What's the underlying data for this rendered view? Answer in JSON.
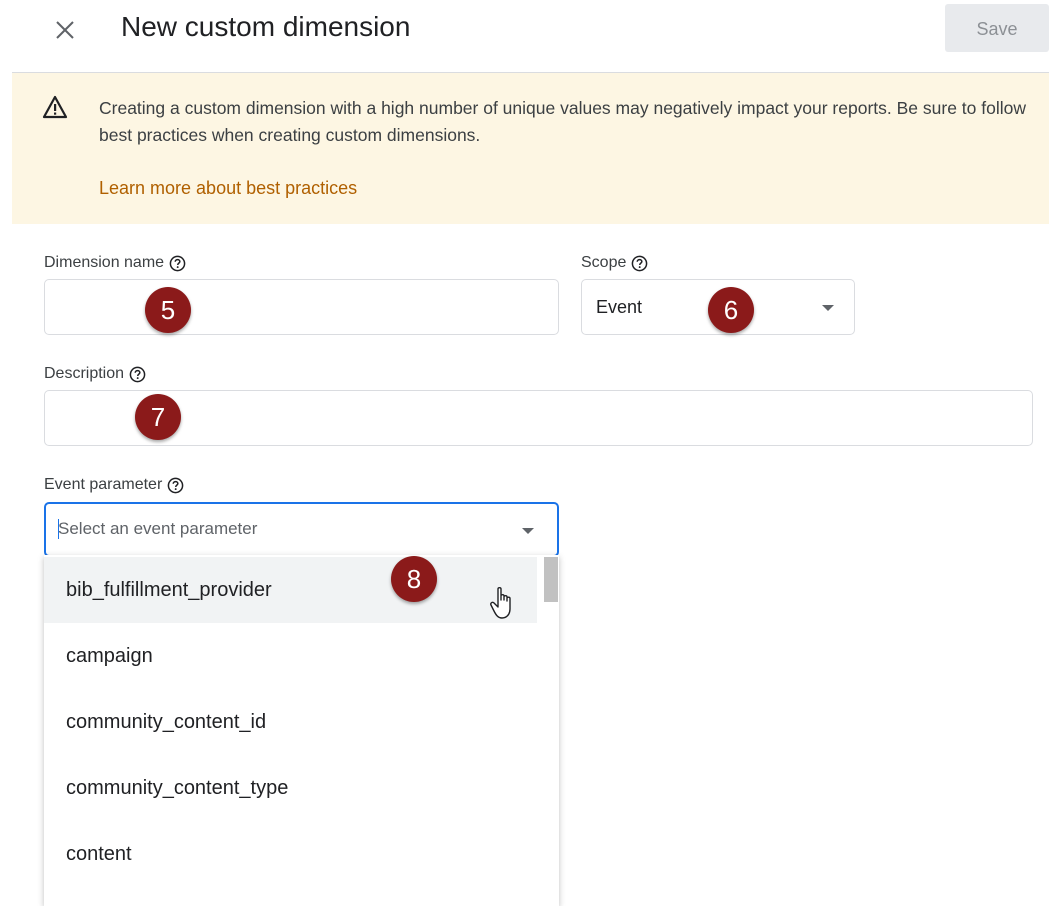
{
  "header": {
    "title": "New custom dimension",
    "save_label": "Save",
    "close_icon": "close-icon"
  },
  "banner": {
    "text": "Creating a custom dimension with a high number of unique values may negatively impact your reports. Be sure to follow best practices when creating custom dimensions.",
    "link": "Learn more about best practices",
    "icon": "warning-icon"
  },
  "form": {
    "dimension_name": {
      "label": "Dimension name",
      "value": "",
      "badge": "5"
    },
    "scope": {
      "label": "Scope",
      "value": "Event",
      "badge": "6"
    },
    "description": {
      "label": "Description",
      "value": "",
      "badge": "7"
    },
    "event_parameter": {
      "label": "Event parameter",
      "placeholder": "Select an event parameter",
      "badge": "8"
    }
  },
  "dropdown": {
    "items": [
      "bib_fulfillment_provider",
      "campaign",
      "community_content_id",
      "community_content_type",
      "content"
    ]
  },
  "colors": {
    "accent": "#1a73e8",
    "banner_bg": "#fdf6e3",
    "link": "#b06000",
    "badge": "#8b1a1a"
  }
}
